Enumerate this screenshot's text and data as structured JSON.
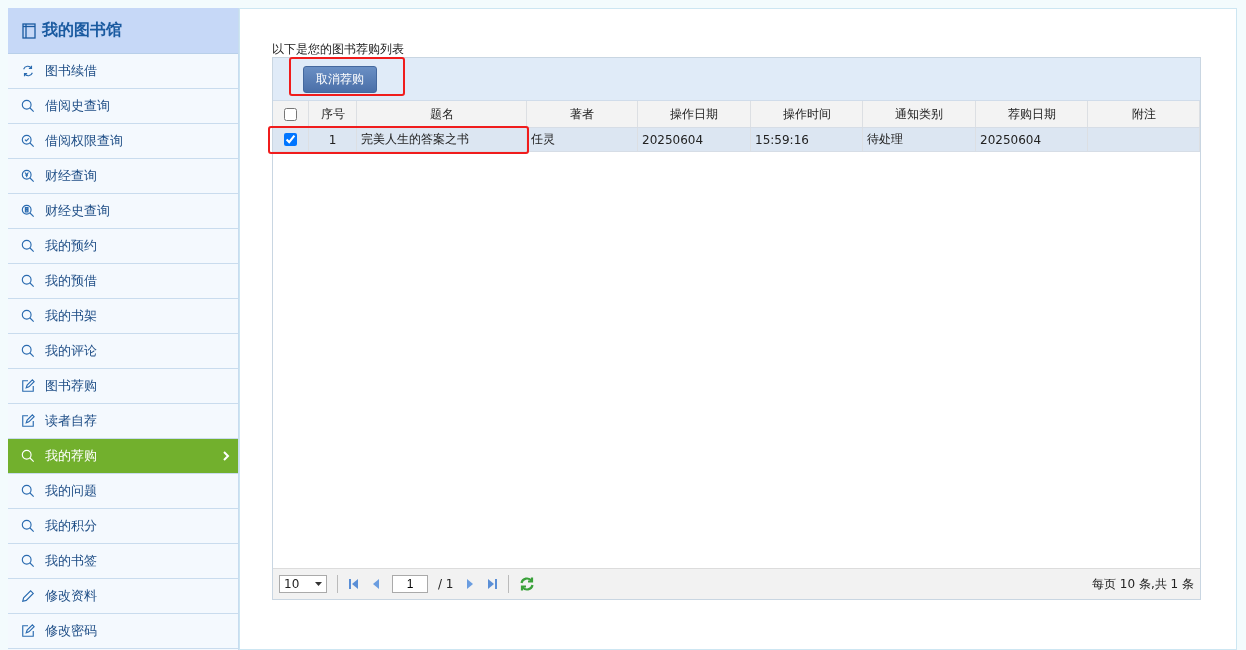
{
  "sidebar": {
    "title": "我的图书馆",
    "items": [
      {
        "label": "图书续借",
        "kind": "renew",
        "selected": false
      },
      {
        "label": "借阅史查询",
        "kind": "search",
        "selected": false
      },
      {
        "label": "借阅权限查询",
        "kind": "search-check",
        "selected": false
      },
      {
        "label": "财经查询",
        "kind": "search-money",
        "selected": false
      },
      {
        "label": "财经史查询",
        "kind": "search-list",
        "selected": false
      },
      {
        "label": "我的预约",
        "kind": "search",
        "selected": false
      },
      {
        "label": "我的预借",
        "kind": "search",
        "selected": false
      },
      {
        "label": "我的书架",
        "kind": "search",
        "selected": false
      },
      {
        "label": "我的评论",
        "kind": "search",
        "selected": false
      },
      {
        "label": "图书荐购",
        "kind": "edit",
        "selected": false
      },
      {
        "label": "读者自荐",
        "kind": "edit",
        "selected": false
      },
      {
        "label": "我的荐购",
        "kind": "search",
        "selected": true
      },
      {
        "label": "我的问题",
        "kind": "search",
        "selected": false
      },
      {
        "label": "我的积分",
        "kind": "search",
        "selected": false
      },
      {
        "label": "我的书签",
        "kind": "search",
        "selected": false
      },
      {
        "label": "修改资料",
        "kind": "pencil",
        "selected": false
      },
      {
        "label": "修改密码",
        "kind": "edit",
        "selected": false
      }
    ]
  },
  "main": {
    "caption": "以下是您的图书荐购列表",
    "toolbar": {
      "button": "取消荐购"
    },
    "table": {
      "columns": [
        "序号",
        "题名",
        "著者",
        "操作日期",
        "操作时间",
        "通知类别",
        "荐购日期",
        "附注"
      ],
      "all_checked": false,
      "rows": [
        {
          "checked": true,
          "cells": [
            "1",
            "完美人生的答案之书",
            "任灵",
            "20250604",
            "15:59:16",
            "待处理",
            "20250604",
            ""
          ]
        }
      ]
    },
    "pager": {
      "page_size": "10",
      "page": "1",
      "total_pages": "/ 1",
      "summary": "每页 10 条,共 1 条"
    }
  }
}
